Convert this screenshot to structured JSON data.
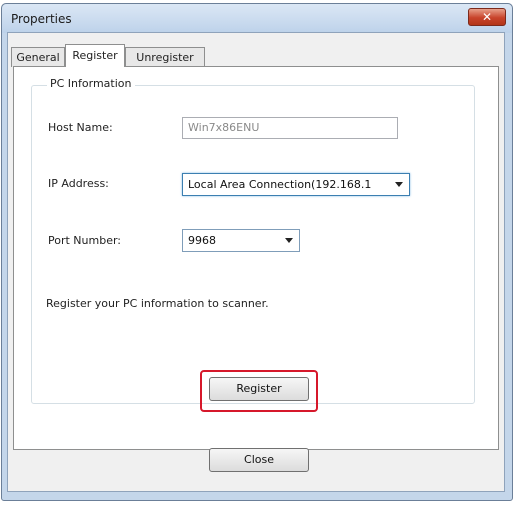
{
  "window": {
    "title": "Properties",
    "close_glyph": "✕",
    "close_icon": "close-icon"
  },
  "tabs": [
    {
      "label": "General",
      "active": false
    },
    {
      "label": "Register",
      "active": true
    },
    {
      "label": "Unregister",
      "active": false
    }
  ],
  "pc_info": {
    "group_title": "PC Information",
    "host_name_label": "Host Name:",
    "host_name_value": "Win7x86ENU",
    "ip_address_label": "IP Address:",
    "ip_address_value": "Local Area Connection(192.168.1",
    "port_number_label": "Port Number:",
    "port_number_value": "9968",
    "message": "Register your PC information to scanner.",
    "register_label": "Register"
  },
  "footer": {
    "close_label": "Close"
  },
  "colors": {
    "highlight": "#d6182b",
    "close_button": "#c8432b"
  }
}
